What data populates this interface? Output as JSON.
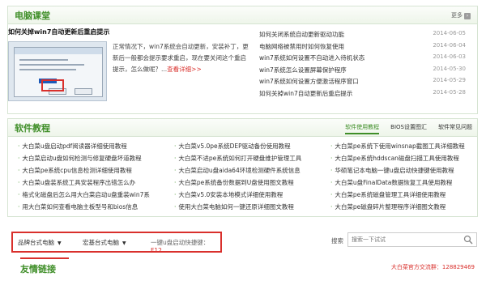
{
  "news": {
    "title": "电脑课堂",
    "more": "更多",
    "featured": {
      "title": "如何关掉win7自动更新后重启提示",
      "desc": "正常情况下，win7系统会自动更新，安装补丁，更新后一般都会提示要求重启，现在要关闭这个重启提示，怎么做呢？...",
      "detail": "查看详细>>"
    },
    "items": [
      {
        "title": "如何关闭系统自动更新驱动功能",
        "date": "2014-06-05"
      },
      {
        "title": "电脑网络被禁用时如何恢复使用",
        "date": "2014-06-04"
      },
      {
        "title": "win7系统如何设置不自动进入待机状态",
        "date": "2014-06-03"
      },
      {
        "title": "win7系统怎么设置屏幕保护程序",
        "date": "2014-05-30"
      },
      {
        "title": "win7系统如何设置方便激活程序窗口",
        "date": "2014-05-29"
      },
      {
        "title": "如何关掉win7自动更新后重启提示",
        "date": "2014-05-28"
      }
    ]
  },
  "tutorials": {
    "title": "软件教程",
    "tabs": [
      "软件使用教程",
      "BIOS设置图汇",
      "软件常见问题"
    ],
    "columns": [
      [
        "大白菜u盘启动pdf阅读器详细使用教程",
        "大白菜启动u盘如何检测与修复硬盘坏道教程",
        "大白菜pe系统cpu信息检测详细使用教程",
        "大白菜u盘装系统工具安装程序出错怎么办",
        "格式化磁盘后怎么用大白菜启动u盘重装win7系",
        "用大白菜如何查看电脑主板型号和bios信息"
      ],
      [
        "大白菜v5.0pe系统DEP驱动备份使用教程",
        "大白菜不进pe系统如何打开硬盘维护管理工具",
        "大白菜启动u盘aida64环境检测硬件系统信息",
        "大白菜pe系统备份数据到U盘使用图文教程",
        "大白菜v5.0安装本地模式详细使用教程",
        "使用大白菜电脑如何一键还原详细图文教程"
      ],
      [
        "大白菜pe系统下使用winsnap截图工具详细教程",
        "大白菜pe系统hddscan磁盘扫描工具使用教程",
        "华硕笔记本电脑一键u盘启动快捷键使用教程",
        "大白菜u盘FinalData数据恢复工具使用教程",
        "大白菜pe系统磁盘管理工具详细使用教程",
        "大白菜pe磁盘碎片整理程序详细图文教程"
      ]
    ]
  },
  "filter": {
    "brand": "品牌台式电脑",
    "model": "宏基台式电脑",
    "hotkey_label": "一键u盘启动快捷键：",
    "hotkey": "F12",
    "search_label": "搜索",
    "search_placeholder": "搜索一下试试"
  },
  "friends": {
    "title": "友情链接",
    "qq": "大白菜官方交流群：128829469"
  }
}
